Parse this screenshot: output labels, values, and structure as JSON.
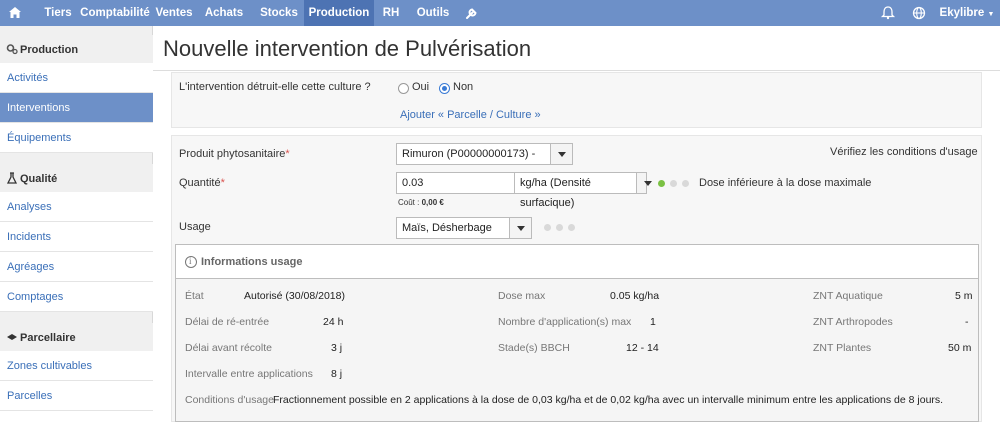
{
  "nav": {
    "home_icon": "home-icon",
    "items": [
      "Tiers",
      "Comptabilité",
      "Ventes",
      "Achats",
      "Stocks",
      "Production",
      "RH",
      "Outils"
    ],
    "active": "Production",
    "tools_icon": "wrench-icon",
    "bell_icon": "bell-icon",
    "globe_icon": "globe-icon",
    "user": "Ekylibre"
  },
  "sidebar": {
    "sections": [
      {
        "title": "Production",
        "icon": "gears-icon",
        "items": [
          "Activités",
          "Interventions",
          "Équipements"
        ]
      },
      {
        "title": "Qualité",
        "icon": "flask-icon",
        "items": [
          "Analyses",
          "Incidents",
          "Agréages",
          "Comptages"
        ]
      },
      {
        "title": "Parcellaire",
        "icon": "map-icon",
        "items": [
          "Zones cultivables",
          "Parcelles"
        ]
      }
    ],
    "active_item": "Interventions"
  },
  "page": {
    "title": "Nouvelle intervention de Pulvérisation"
  },
  "destroy_question": {
    "label": "L'intervention détruit-elle cette culture ?",
    "options": [
      "Oui",
      "Non"
    ],
    "selected": "Non",
    "add_link": "Ajouter « Parcelle / Culture »"
  },
  "product": {
    "label": "Produit phytosanitaire",
    "required_mark": "*",
    "value": "Rimuron (P00000000173) -",
    "check_link": "Vérifiez les conditions d'usage"
  },
  "quantity": {
    "label": "Quantité",
    "required_mark": "*",
    "value": "0.03",
    "unit": "kg/ha (Densité surfacique)",
    "cost_label": "Coût :",
    "cost_value": "0,00 €",
    "status_text": "Dose inférieure à la dose maximale",
    "status_color": "#7bc144"
  },
  "usage": {
    "label": "Usage",
    "value": "Maïs, Désherbage"
  },
  "info": {
    "title": "Informations usage",
    "col1": [
      {
        "k": "État",
        "v": "Autorisé (30/08/2018)"
      },
      {
        "k": "Délai de ré-entrée",
        "v": "24 h"
      },
      {
        "k": "Délai avant récolte",
        "v": "3 j"
      },
      {
        "k": "Intervalle entre applications",
        "v": "8 j"
      }
    ],
    "col2": [
      {
        "k": "Dose max",
        "v": "0.05 kg/ha"
      },
      {
        "k": "Nombre d'application(s) max",
        "v": "1"
      },
      {
        "k": "Stade(s) BBCH",
        "v": "12 - 14"
      }
    ],
    "col3": [
      {
        "k": "ZNT Aquatique",
        "v": "5 m"
      },
      {
        "k": "ZNT Arthropodes",
        "v": "-"
      },
      {
        "k": "ZNT Plantes",
        "v": "50 m"
      }
    ],
    "conditions_label": "Conditions d'usage",
    "conditions_value": "Fractionnement possible en 2 applications à la dose de 0,03 kg/ha et de 0,02 kg/ha avec un intervalle minimum entre les applications de 8 jours."
  },
  "colors": {
    "nav": "#6d90c8",
    "nav_active": "#4d73b3",
    "link": "#3a6fb8"
  }
}
